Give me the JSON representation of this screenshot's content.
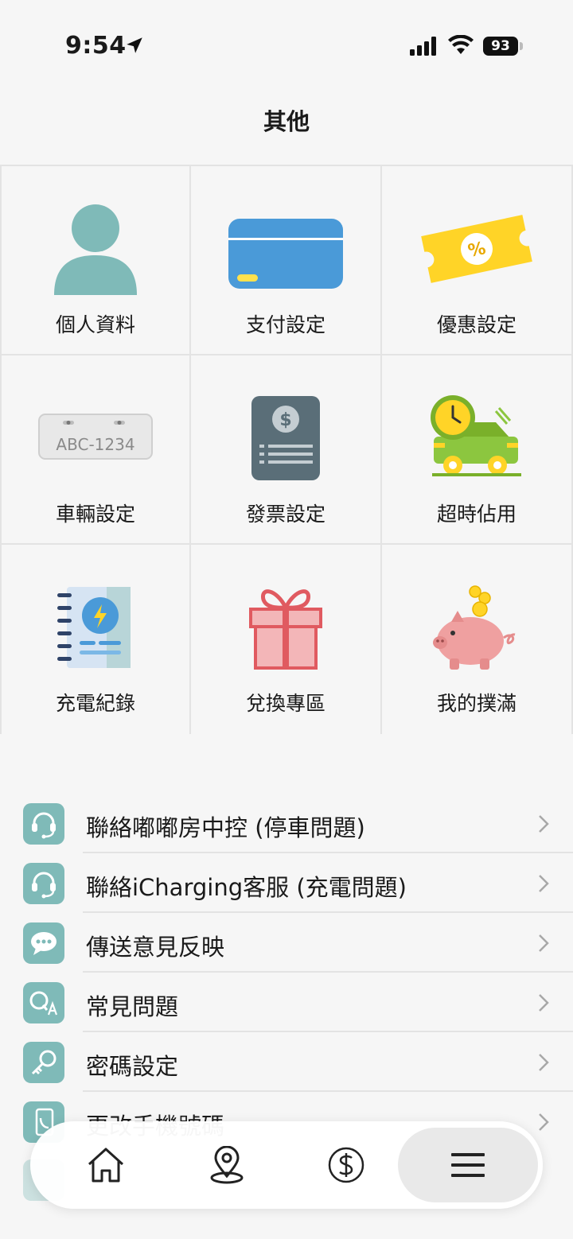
{
  "status": {
    "time": "9:54",
    "battery": "93"
  },
  "page": {
    "title": "其他"
  },
  "grid": [
    {
      "label": "個人資料",
      "icon": "person-icon"
    },
    {
      "label": "支付設定",
      "icon": "credit-card-icon"
    },
    {
      "label": "優惠設定",
      "icon": "coupon-icon"
    },
    {
      "label": "車輛設定",
      "icon": "license-plate-icon",
      "plate": "ABC-1234"
    },
    {
      "label": "發票設定",
      "icon": "invoice-icon"
    },
    {
      "label": "超時佔用",
      "icon": "overtime-car-icon"
    },
    {
      "label": "充電紀錄",
      "icon": "charging-record-icon"
    },
    {
      "label": "兌換專區",
      "icon": "gift-icon"
    },
    {
      "label": "我的撲滿",
      "icon": "piggy-bank-icon"
    }
  ],
  "list": [
    {
      "label": "聯絡嘟嘟房中控 (停車問題)",
      "icon": "headset-icon"
    },
    {
      "label": "聯絡iCharging客服 (充電問題)",
      "icon": "headset-icon"
    },
    {
      "label": "傳送意見反映",
      "icon": "chat-bubble-icon"
    },
    {
      "label": "常見問題",
      "icon": "qa-icon"
    },
    {
      "label": "密碼設定",
      "icon": "key-icon"
    },
    {
      "label": "更改手機號碼",
      "icon": "phone-icon"
    }
  ],
  "tabbar": {
    "items": [
      {
        "icon": "home-icon"
      },
      {
        "icon": "map-pin-icon"
      },
      {
        "icon": "dollar-icon"
      },
      {
        "icon": "menu-icon",
        "active": true
      }
    ]
  },
  "colors": {
    "teal": "#7fbab8",
    "card_blue": "#4a9ad8",
    "coupon_yellow": "#ffd427",
    "invoice_slate": "#5a6e78",
    "gift_pink": "#f3b6b8",
    "piggy_pink": "#efa0a0"
  }
}
